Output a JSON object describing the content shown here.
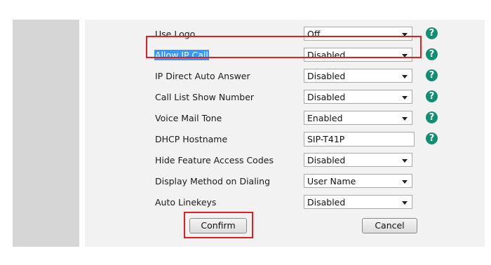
{
  "colors": {
    "help_icon": "#0f8f73",
    "highlight": "#e02020",
    "selection": "#3399ff"
  },
  "settings": [
    {
      "label": "Use Logo",
      "control": "select",
      "value": "Off",
      "help": true
    },
    {
      "label": "Allow IP Call",
      "control": "select",
      "value": "Disabled",
      "help": true,
      "selected": true
    },
    {
      "label": "IP Direct Auto Answer",
      "control": "select",
      "value": "Disabled",
      "help": true
    },
    {
      "label": "Call List Show Number",
      "control": "select",
      "value": "Disabled",
      "help": true
    },
    {
      "label": "Voice Mail Tone",
      "control": "select",
      "value": "Enabled",
      "help": true
    },
    {
      "label": "DHCP Hostname",
      "control": "text",
      "value": "SIP-T41P",
      "help": true
    },
    {
      "label": "Hide Feature Access Codes",
      "control": "select",
      "value": "Disabled",
      "help": false
    },
    {
      "label": "Display Method on Dialing",
      "control": "select",
      "value": "User Name",
      "help": false
    },
    {
      "label": "Auto Linekeys",
      "control": "select",
      "value": "Disabled",
      "help": false
    }
  ],
  "help_icon_glyph": "?",
  "buttons": {
    "confirm": "Confirm",
    "cancel": "Cancel"
  }
}
